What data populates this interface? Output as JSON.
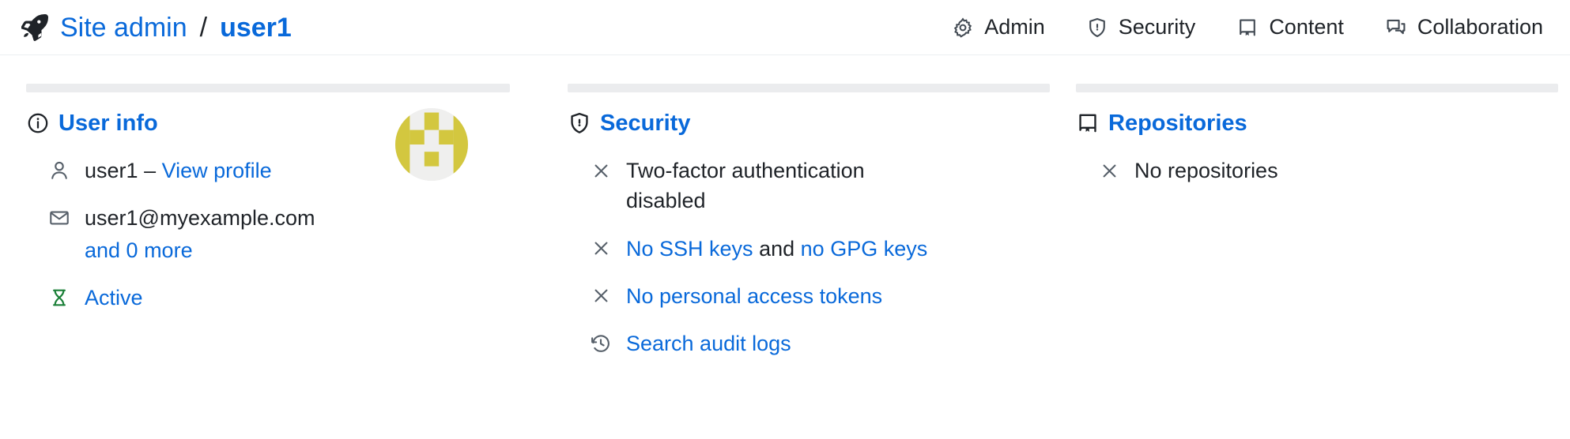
{
  "header": {
    "rocket_icon": "rocket-icon",
    "breadcrumb": {
      "root_label": "Site admin",
      "separator": "/",
      "current_label": "user1"
    },
    "nav": [
      {
        "label": "Admin",
        "icon": "gear-icon"
      },
      {
        "label": "Security",
        "icon": "shield-lock-icon"
      },
      {
        "label": "Content",
        "icon": "repo-icon"
      },
      {
        "label": "Collaboration",
        "icon": "comment-discussion-icon"
      }
    ]
  },
  "cards": {
    "user_info": {
      "heading": "User info",
      "heading_icon": "info-circle-icon",
      "avatar": "identicon-avatar",
      "rows": {
        "username": "user1",
        "dash": "–",
        "view_profile": "View profile",
        "email": "user1@myexample.com",
        "and_more": "and 0 more",
        "status": "Active"
      }
    },
    "security": {
      "heading": "Security",
      "heading_icon": "shield-lock-icon",
      "rows": {
        "two_factor": "Two-factor authentication disabled",
        "no_ssh_keys": "No SSH keys",
        "and": "and",
        "no_gpg_keys": "no GPG keys",
        "no_tokens": "No personal access tokens",
        "audit_logs": "Search audit logs"
      }
    },
    "repositories": {
      "heading": "Repositories",
      "heading_icon": "repo-icon",
      "rows": {
        "empty": "No repositories"
      }
    }
  },
  "colors": {
    "link": "#0969da",
    "text": "#1f2328",
    "muted_icon": "#57606a",
    "success": "#1a7f37",
    "bar": "#ebecee",
    "avatar_fill": "#d3c73f",
    "avatar_bg": "#efefee"
  }
}
